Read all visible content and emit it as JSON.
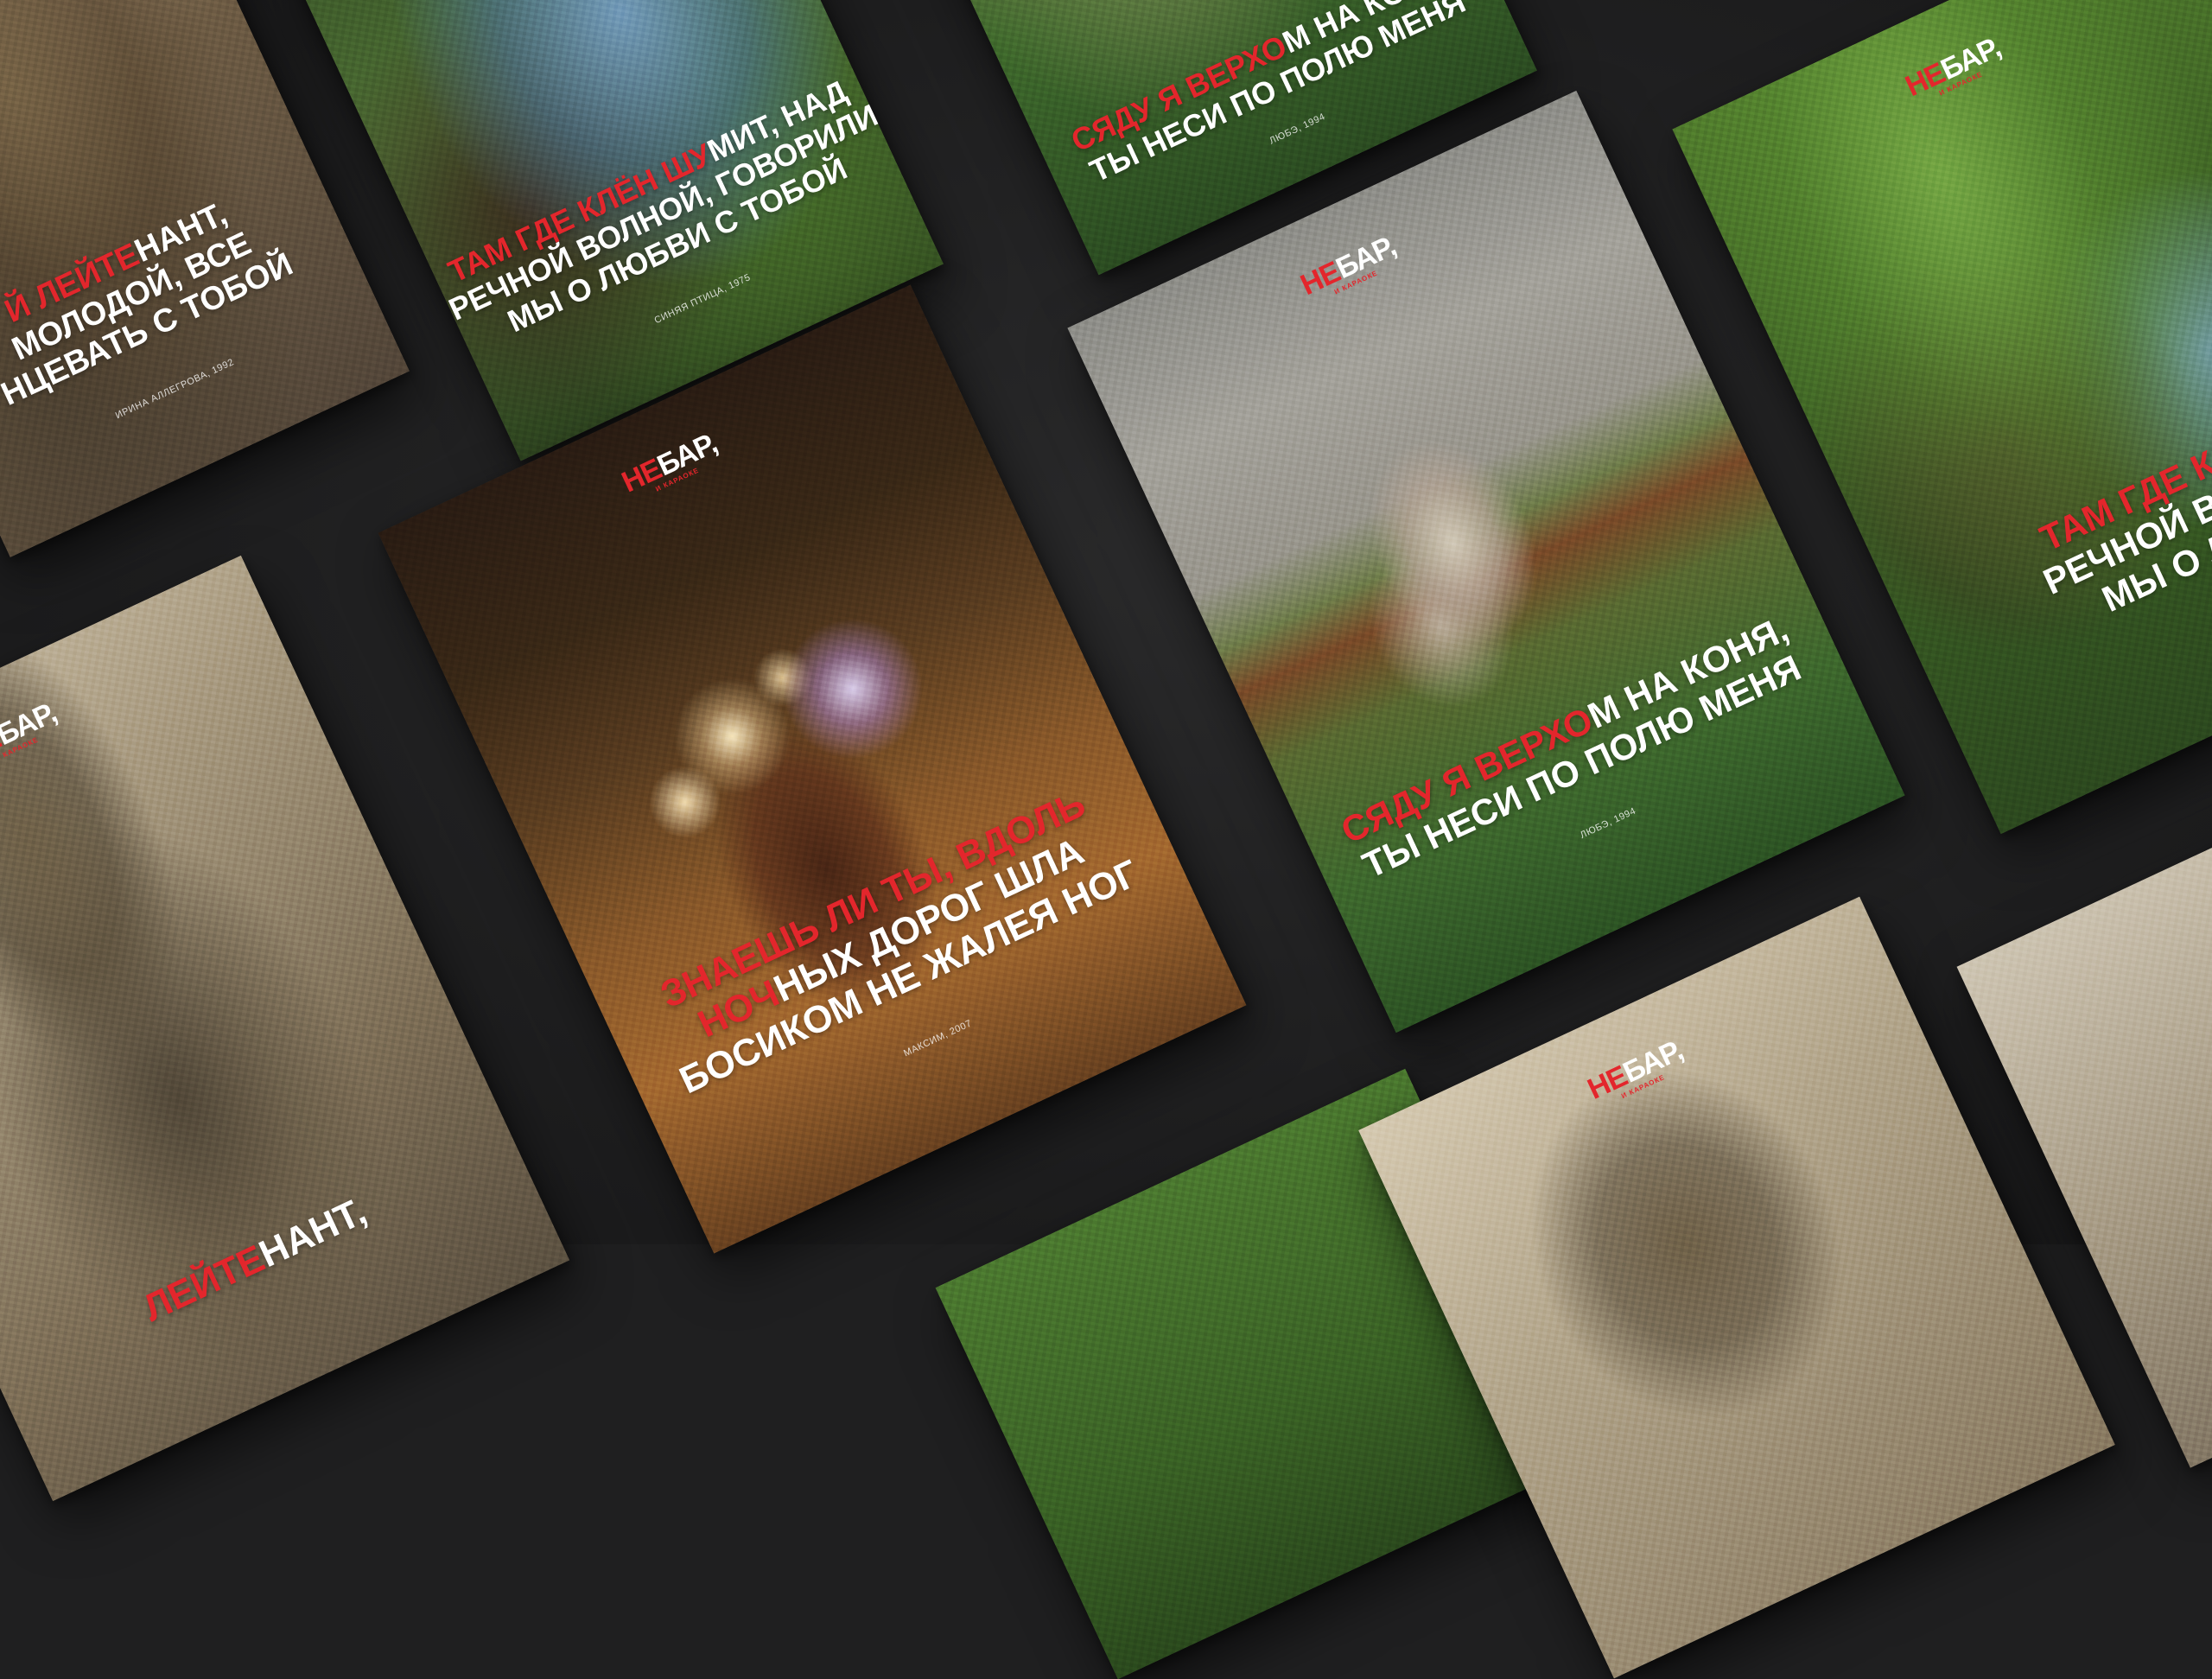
{
  "brand": {
    "highlight": "НЕ",
    "rest": "БАР,",
    "sub": "И КАРАОКЕ"
  },
  "colors": {
    "accent": "#e3262c",
    "surface": "#1f1f20"
  },
  "posters": {
    "horse": {
      "lyric_line1_red": "СЯДУ Я ВЕРХО",
      "lyric_line1_white": "М НА КОНЯ,",
      "lyric_line2_white": "ТЫ НЕСИ ПО ПОЛЮ МЕНЯ",
      "credit": "ЛЮБЭ, 1994"
    },
    "night": {
      "lyric_line1_red": "ЗНАЕШЬ ЛИ ТЫ, ВДОЛЬ",
      "lyric_line2_red": "НОЧ",
      "lyric_line2_white": "НЫХ ДОРОГ ШЛА",
      "lyric_line3_white": "БОСИКОМ НЕ ЖАЛЕЯ НОГ",
      "credit": "МАКСИМ, 2007"
    },
    "tree_top": {
      "lyric_line1_red": "ТАМ ГДЕ КЛЁН ШУ",
      "lyric_line1_white": "МИТ, НАД",
      "lyric_line2_white": "РЕЧНОЙ ВОЛНОЙ, ГОВОРИЛИ",
      "lyric_line3_white": "МЫ О ЛЮБВИ С ТОБОЙ",
      "credit": "СИНЯЯ ПТИЦА, 1975"
    },
    "soldier_top": {
      "lyric_line1_red": "Й ЛЕЙТЕ",
      "lyric_line1_white": "НАНТ,",
      "lyric_line2_white": "МОЛОДОЙ, ВСЕ",
      "lyric_line3_white": "НЦЕВАТЬ С ТОБОЙ",
      "credit": "ИРИНА АЛЛЕГРОВА, 1992"
    },
    "horse_top": {
      "lyric_line1_red": "СЯДУ Я ВЕРХО",
      "lyric_line1_white": "М НА КОНЯ,",
      "lyric_line2_white": "ТЫ НЕСИ ПО ПОЛЮ МЕНЯ",
      "credit": "ЛЮБЭ, 1994"
    },
    "tree_right": {
      "lyric_line1_red": "ТАМ ГДЕ КЛЁ",
      "lyric_line1_white": "",
      "lyric_line2_white": "РЕЧНОЙ ВОЛН",
      "lyric_line3_white": "МЫ О ЛЮ"
    },
    "soldier_bottom": {
      "lyric_line1_red": "ЛЕЙТЕ",
      "lyric_line1_white": "НАНТ,"
    }
  }
}
